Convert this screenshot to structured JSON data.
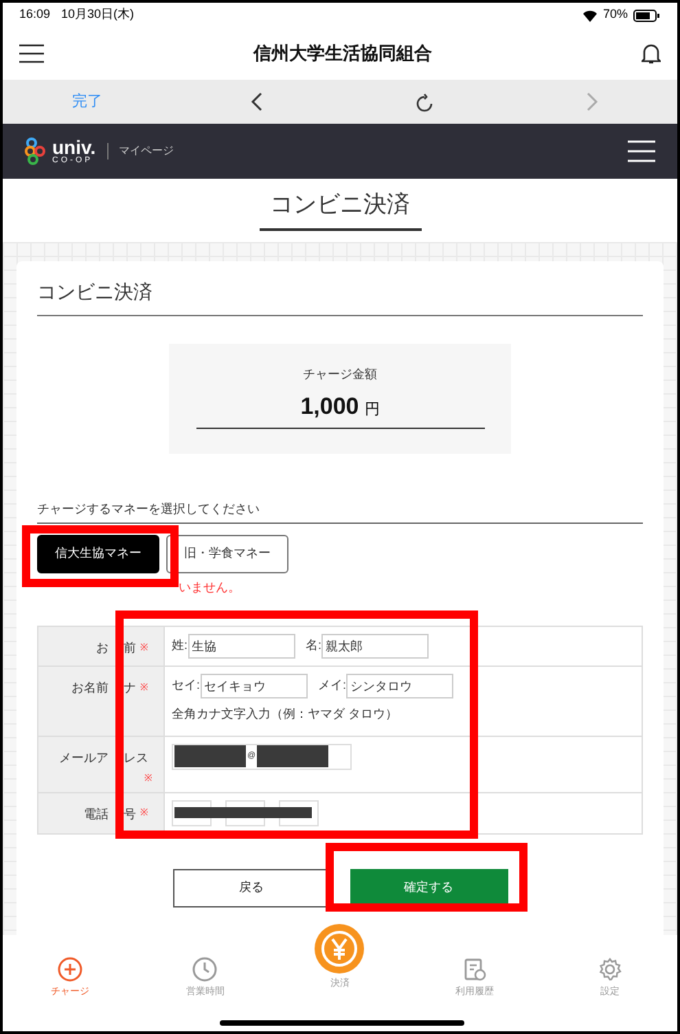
{
  "status_bar": {
    "time": "16:09",
    "date": "10月30日(木)",
    "battery": "70%"
  },
  "app_header": {
    "title": "信州大学生活協同組合"
  },
  "browser_toolbar": {
    "done": "完了"
  },
  "site_nav": {
    "logo_main": "univ.",
    "logo_sub": "CO-OP",
    "section": "マイページ"
  },
  "page_title": "コンビニ決済",
  "card": {
    "title": "コンビニ決済",
    "amount": {
      "label": "チャージ金額",
      "value": "1,000",
      "unit": "円"
    },
    "money_prompt": "チャージするマネーを選択してください",
    "money_options": [
      {
        "label": "信大生協マネー",
        "selected": true
      },
      {
        "label": "旧・学食マネー",
        "selected": false
      }
    ],
    "error": "いません。",
    "form_rows": [
      {
        "kind": "name",
        "label": [
          "お",
          "前"
        ],
        "required": "※",
        "fields": [
          {
            "prefix": "姓:",
            "value": "生協"
          },
          {
            "prefix": "名:",
            "value": "親太郎"
          }
        ]
      },
      {
        "kind": "name",
        "label": [
          "お名前",
          "ナ"
        ],
        "required": "※",
        "fields": [
          {
            "prefix": "セイ:",
            "value": "セイキョウ"
          },
          {
            "prefix": "メイ:",
            "value": "シンタロウ"
          }
        ],
        "hint": "全角カナ文字入力（例：ヤマダ タロウ）"
      },
      {
        "kind": "email",
        "label": [
          "メールア",
          "レス"
        ],
        "required": "※",
        "at": "@"
      },
      {
        "kind": "phone",
        "label": [
          "電話",
          "号"
        ],
        "required": "※"
      }
    ],
    "buttons": [
      {
        "label": "戻る",
        "kind": "back"
      },
      {
        "label": "確定する",
        "kind": "confirm"
      }
    ]
  },
  "tab_bar": [
    {
      "label": "チャージ",
      "selected": true
    },
    {
      "label": "営業時間",
      "selected": false
    },
    {
      "label": "決済",
      "selected": false
    },
    {
      "label": "利用履歴",
      "selected": false
    },
    {
      "label": "設定",
      "selected": false
    }
  ]
}
